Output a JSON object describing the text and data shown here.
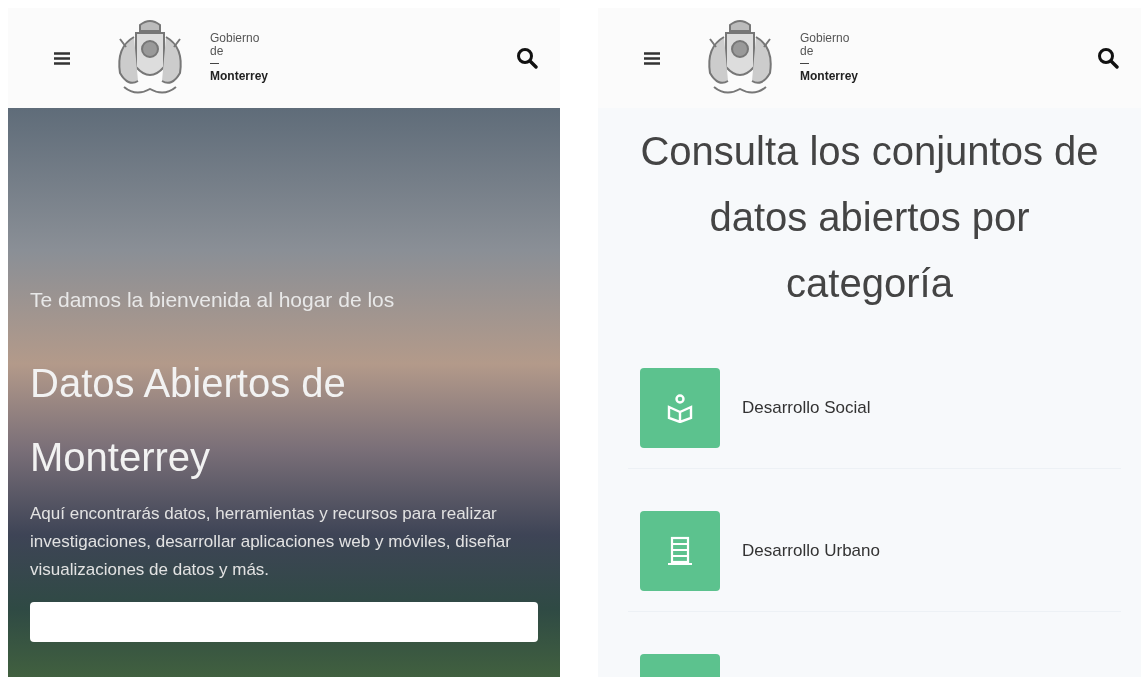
{
  "screens": [
    {
      "kind": "hero",
      "header": {
        "logo_lines": [
          "Gobierno",
          "de",
          "Monterrey"
        ]
      },
      "hero": {
        "kicker": "Te damos la bienvenida al hogar de los",
        "title": "Datos Abiertos de Monterrey",
        "body": "Aquí encontrarás datos, herramientas y recursos para realizar investigaciones, desarrollar aplicaciones web y móviles, diseñar visualizaciones de datos y más."
      }
    },
    {
      "kind": "categories",
      "header": {
        "logo_lines": [
          "Gobierno",
          "de",
          "Monterrey"
        ]
      },
      "heading": "Consulta los conjuntos de datos abiertos por categoría",
      "categories": [
        {
          "kind": "social",
          "label": "Desarrollo Social"
        },
        {
          "kind": "urban",
          "label": "Desarrollo Urbano"
        },
        {
          "kind": "cut_off"
        }
      ]
    }
  ]
}
